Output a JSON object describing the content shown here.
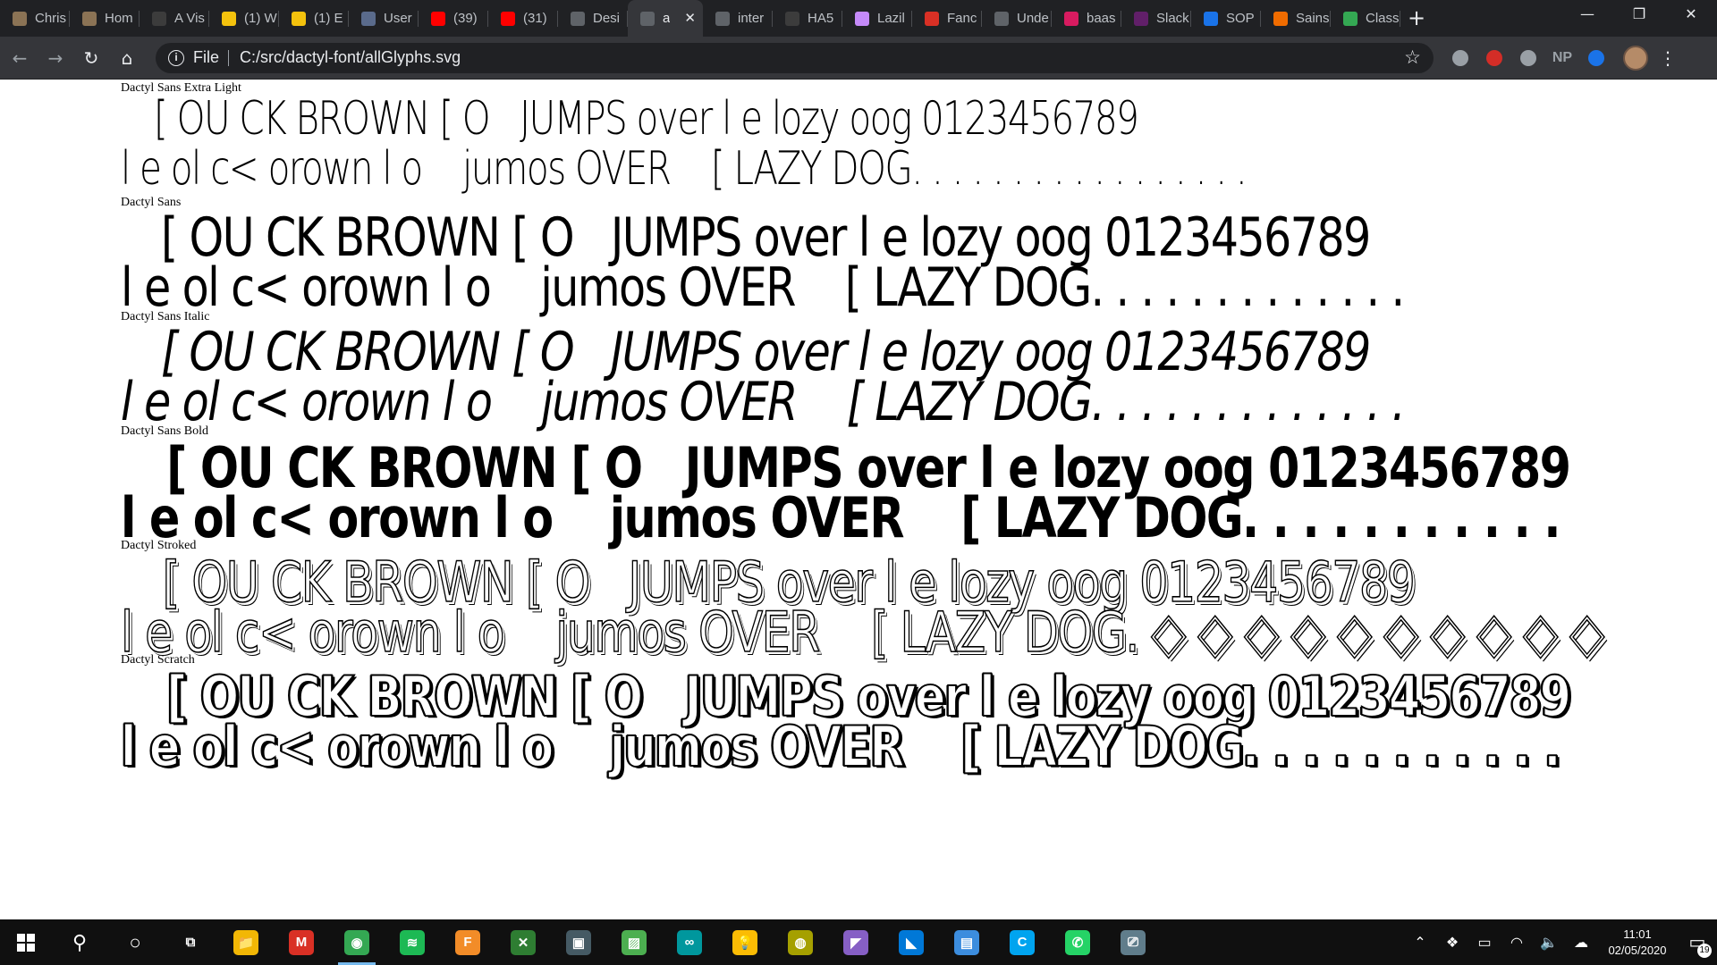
{
  "browser": {
    "tabs": [
      {
        "title": "Chris",
        "icon": "chris-avatar-icon",
        "color": "#8b7355"
      },
      {
        "title": "Hom",
        "icon": "home-avatar-icon",
        "color": "#8b7355"
      },
      {
        "title": "A Vis",
        "icon": "a-vis-icon",
        "color": "#3c3c3c"
      },
      {
        "title": "(1) W",
        "icon": "g-icon",
        "color": "#f4c20d"
      },
      {
        "title": "(1) E",
        "icon": "g-icon",
        "color": "#f4c20d"
      },
      {
        "title": "User",
        "icon": "user-grid-icon",
        "color": "#5a6b8c"
      },
      {
        "title": "(39)",
        "icon": "youtube-icon",
        "color": "#ff0000"
      },
      {
        "title": "(31)",
        "icon": "youtube-icon",
        "color": "#ff0000"
      },
      {
        "title": "Desi",
        "icon": "globe-icon",
        "color": "#5f6368"
      },
      {
        "title": "a",
        "icon": "globe-icon",
        "color": "#5f6368",
        "active": true
      },
      {
        "title": "inter",
        "icon": "globe-icon",
        "color": "#5f6368"
      },
      {
        "title": "HA5",
        "icon": "code-icon",
        "color": "#3c3c3c"
      },
      {
        "title": "Lazil",
        "icon": "cursor-icon",
        "color": "#c58af9"
      },
      {
        "title": "Fanc",
        "icon": "fancy-icon",
        "color": "#d93025"
      },
      {
        "title": "Unde",
        "icon": "globe-icon",
        "color": "#5f6368"
      },
      {
        "title": "baas",
        "icon": "baas-icon",
        "color": "#d81b60"
      },
      {
        "title": "Slack",
        "icon": "slack-icon",
        "color": "#611f69"
      },
      {
        "title": "SOP",
        "icon": "sop-icon",
        "color": "#1a73e8"
      },
      {
        "title": "Sains",
        "icon": "sainsburys-icon",
        "color": "#f06c00"
      },
      {
        "title": "Class",
        "icon": "classroom-icon",
        "color": "#34a853"
      }
    ],
    "new_tab": "+",
    "window_controls": {
      "minimize": "—",
      "maximize": "❐",
      "close": "✕"
    },
    "nav": {
      "back": "←",
      "forward": "→",
      "reload": "↻",
      "home": "⌂"
    },
    "omnibox": {
      "scheme": "File",
      "url": "C:/src/dactyl-font/allGlyphs.svg"
    },
    "star": "☆",
    "extensions": [
      {
        "name": "shield-extension-icon",
        "label": "",
        "color": "#9aa0a6"
      },
      {
        "name": "lastpass-extension-icon",
        "label": "",
        "color": "#d32d27"
      },
      {
        "name": "puzzle-extension-icon",
        "label": "",
        "color": "#9aa0a6"
      },
      {
        "name": "np-extension-icon",
        "label": "NP",
        "color": "#9aa0a6"
      },
      {
        "name": "drop-extension-icon",
        "label": "",
        "color": "#1a73e8"
      }
    ],
    "menu": "⋮"
  },
  "page": {
    "sections": [
      {
        "label": "Dactyl Sans Extra Light",
        "style": "extralight",
        "line1": "   [ OU CK BROWN [ O   JUMPS over l e lozy oog 0123456789",
        "line2": "l e ol c< orown l o    jumos OVER    [ LAZY DOG. . . . . . . . . . . . . . . . ."
      },
      {
        "label": "Dactyl Sans",
        "style": "regular",
        "line1": "   [ OU CK BROWN [ O   JUMPS over l e lozy oog 0123456789",
        "line2": "l e ol c< orown l o    jumos OVER    [ LAZY DOG. . . . . . . . . . . . ."
      },
      {
        "label": "Dactyl Sans Italic",
        "style": "italic",
        "line1": "   [ OU CK BROWN [ O   JUMPS over l e lozy oog 0123456789",
        "line2": "l e ol c< orown l o    jumos OVER    [ LAZY DOG. . . . . . . . . . . . ."
      },
      {
        "label": "Dactyl Sans Bold",
        "style": "bold",
        "line1": "   [ OU CK BROWN [ O   JUMPS over l e lozy oog 0123456789",
        "line2": "l e ol c< orown l o    jumos OVER    [ LAZY DOG. . . . . . . . . . ."
      },
      {
        "label": "Dactyl Stroked",
        "style": "stroked",
        "line1": "   [ OU CK BROWN [ O   JUMPS over l e lozy oog 0123456789",
        "line2": "l e ol c< orown l o    jumos OVER    [ LAZY DOG. ◇ ◇ ◇ ◇ ◇ ◇ ◇ ◇ ◇ ◇"
      },
      {
        "label": "Dactyl Scratch",
        "style": "scratch",
        "line1": "   [ OU CK BROWN [ O   JUMPS over l e lozy oog 0123456789",
        "line2": "l e ol c< orown l o    jumos OVER    [ LAZY DOG. . . . . . . . . . ."
      }
    ]
  },
  "taskbar": {
    "search": "⚲",
    "task_view": "○",
    "apps": [
      {
        "name": "timeline-icon",
        "glyph": "⧉",
        "color": "#101010",
        "running": false
      },
      {
        "name": "file-explorer-icon",
        "glyph": "📁",
        "color": "#f2b705",
        "running": false
      },
      {
        "name": "gmail-icon",
        "glyph": "M",
        "color": "#d93025",
        "running": false
      },
      {
        "name": "chrome-icon",
        "glyph": "◉",
        "color": "#34a853",
        "running": true
      },
      {
        "name": "spotify-icon",
        "glyph": "≋",
        "color": "#1db954",
        "running": false
      },
      {
        "name": "fontforge-icon",
        "glyph": "F",
        "color": "#f28c28",
        "running": false
      },
      {
        "name": "xmind-icon",
        "glyph": "✕",
        "color": "#2e7d32",
        "running": false
      },
      {
        "name": "terminal-icon",
        "glyph": "▣",
        "color": "#455a64",
        "running": false
      },
      {
        "name": "image-viewer-icon",
        "glyph": "▨",
        "color": "#4caf50",
        "running": false
      },
      {
        "name": "arduino-icon",
        "glyph": "∞",
        "color": "#00979d",
        "running": false
      },
      {
        "name": "keep-icon",
        "glyph": "💡",
        "color": "#fbbc04",
        "running": false
      },
      {
        "name": "globe-app-icon",
        "glyph": "◍",
        "color": "#a5a000",
        "running": false
      },
      {
        "name": "visual-studio-icon",
        "glyph": "◤",
        "color": "#865fc5",
        "running": false
      },
      {
        "name": "vscode-icon",
        "glyph": "◣",
        "color": "#0078d7",
        "running": false
      },
      {
        "name": "notepad-icon",
        "glyph": "▤",
        "color": "#3c8dde",
        "running": false
      },
      {
        "name": "cortana-c-icon",
        "glyph": "C",
        "color": "#00a4ef",
        "running": false
      },
      {
        "name": "whatsapp-icon",
        "glyph": "✆",
        "color": "#25d366",
        "running": false
      },
      {
        "name": "remote-desktop-icon",
        "glyph": "⎚",
        "color": "#607d8b",
        "running": false
      }
    ],
    "tray": {
      "chevron": "⌃",
      "dropbox": "❖",
      "battery": "▭",
      "wifi": "◠",
      "volume": "🔈",
      "onedrive": "☁",
      "time": "11:01",
      "date": "02/05/2020",
      "notifications_badge": "19"
    }
  }
}
